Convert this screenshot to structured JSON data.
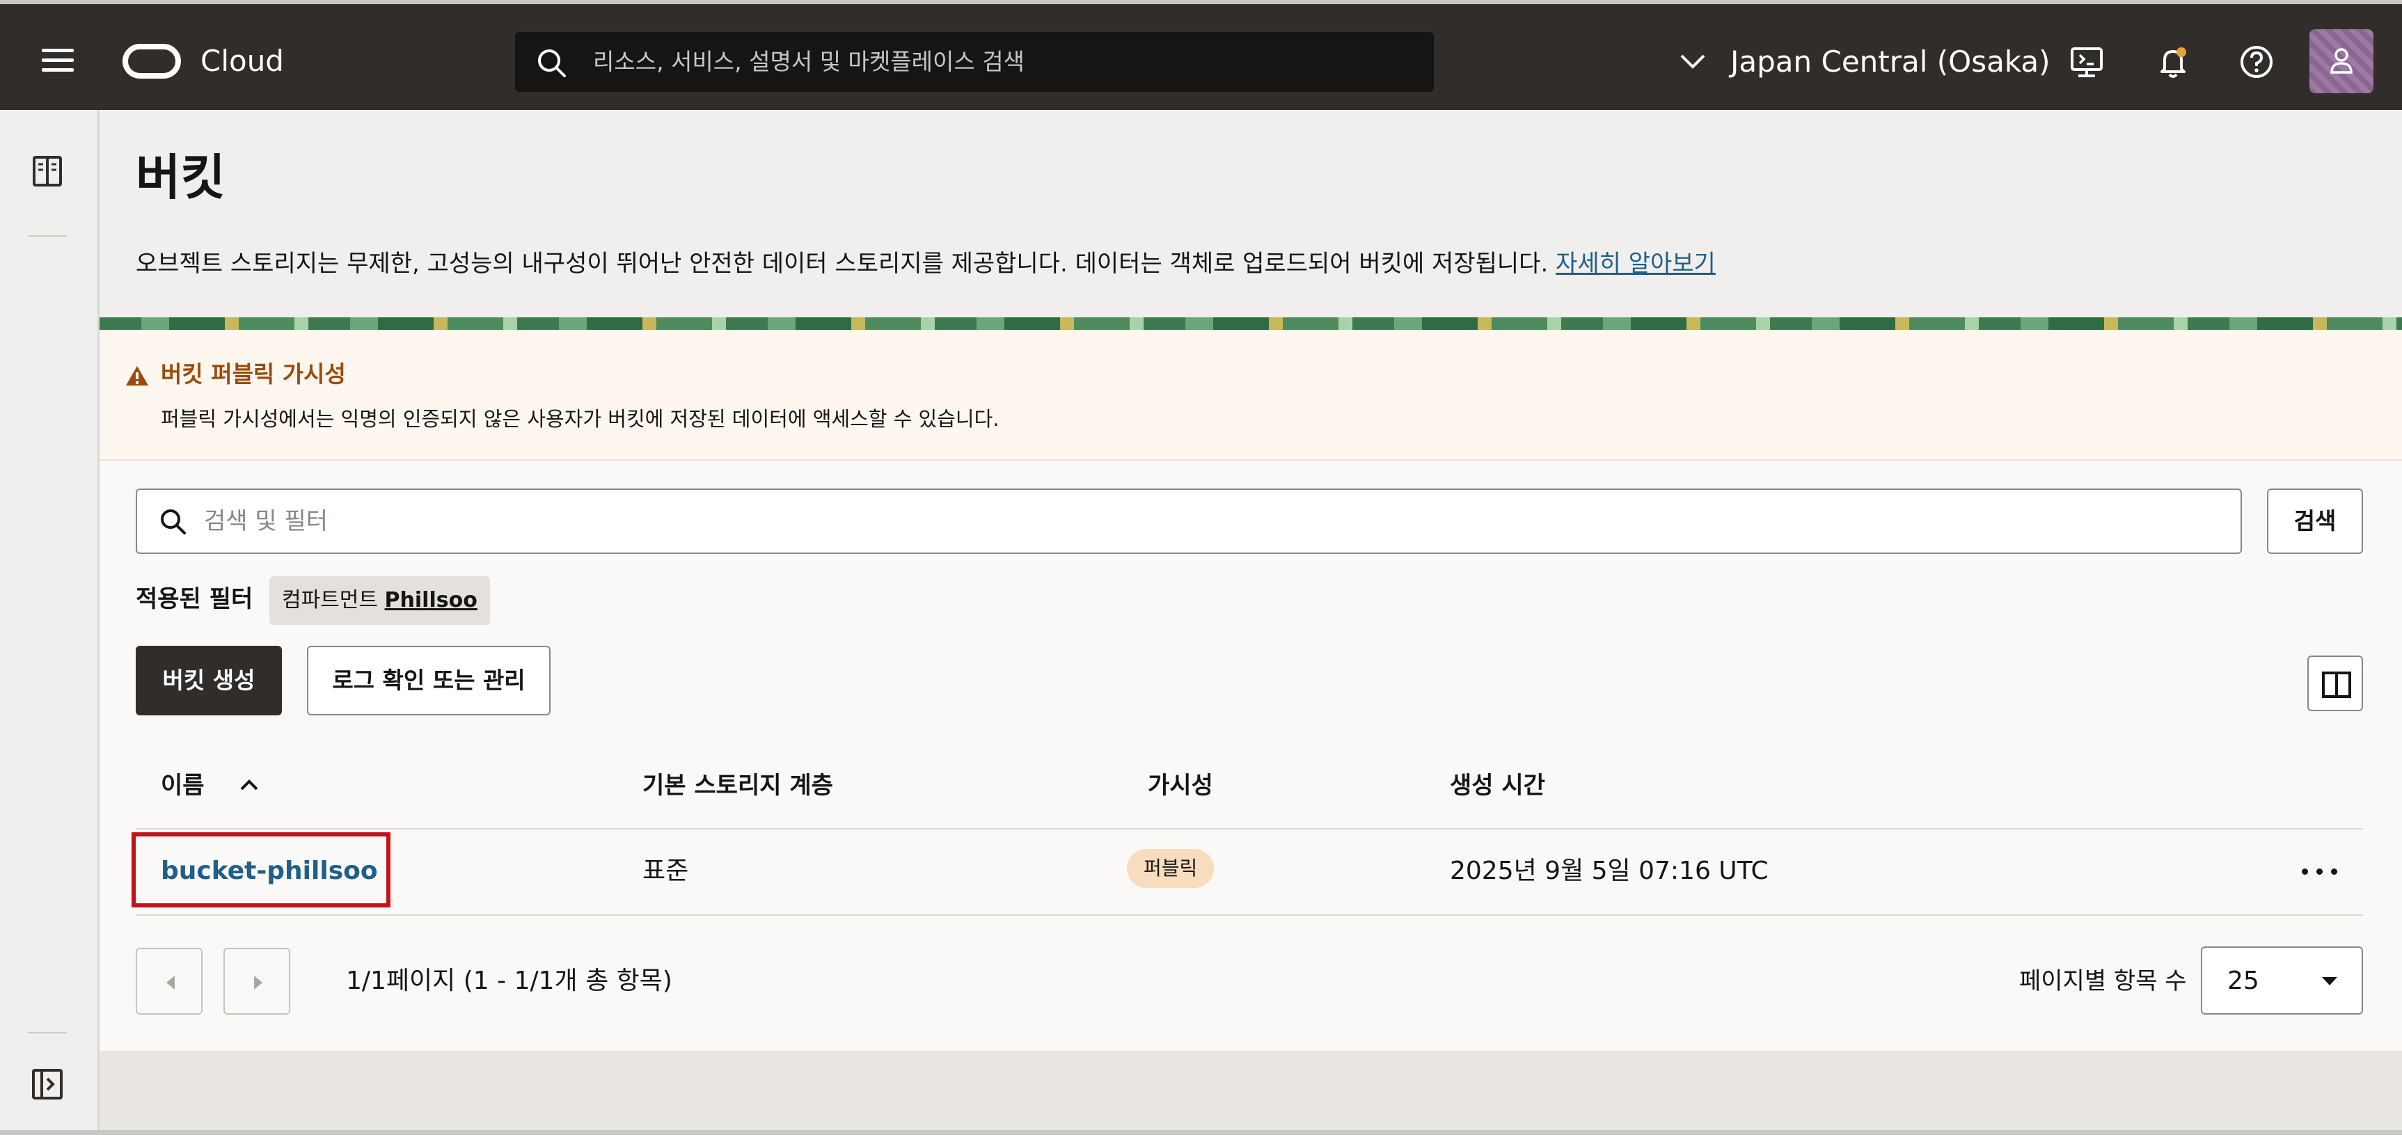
{
  "header": {
    "brand": "Cloud",
    "search_placeholder": "리소스, 서비스, 설명서 및 마켓플레이스 검색",
    "region": "Japan Central (Osaka)"
  },
  "page": {
    "title": "버킷",
    "description": "오브젝트 스토리지는 무제한, 고성능의 내구성이 뛰어난 안전한 데이터 스토리지를 제공합니다. 데이터는 객체로 업로드되어 버킷에 저장됩니다.",
    "learn_more": "자세히 알아보기"
  },
  "warning": {
    "title": "버킷 퍼블릭 가시성",
    "text": "퍼블릭 가시성에서는 익명의 인증되지 않은 사용자가 버킷에 저장된 데이터에 액세스할 수 있습니다."
  },
  "filter": {
    "placeholder": "검색 및 필터",
    "search_button": "검색",
    "applied_label": "적용된 필터",
    "chip_key": "컴파트먼트",
    "chip_value": "Phillsoo"
  },
  "actions": {
    "create": "버킷 생성",
    "logs": "로그 확인 또는 관리"
  },
  "table": {
    "columns": [
      "이름",
      "기본 스토리지 계층",
      "가시성",
      "생성 시간"
    ],
    "rows": [
      {
        "name": "bucket-phillsoo",
        "tier": "표준",
        "visibility": "퍼블릭",
        "created": "2025년 9월 5일 07:16 UTC"
      }
    ]
  },
  "pagination": {
    "summary": "1/1페이지 (1 - 1/1개 총 항목)",
    "per_page_label": "페이지별 항목 수",
    "per_page_value": "25"
  },
  "colors": {
    "topbar": "#312d2a",
    "link": "#1f5f8a",
    "warning_title": "#9a4b09",
    "highlight": "#c0141a",
    "badge": "#f7dcbd"
  }
}
